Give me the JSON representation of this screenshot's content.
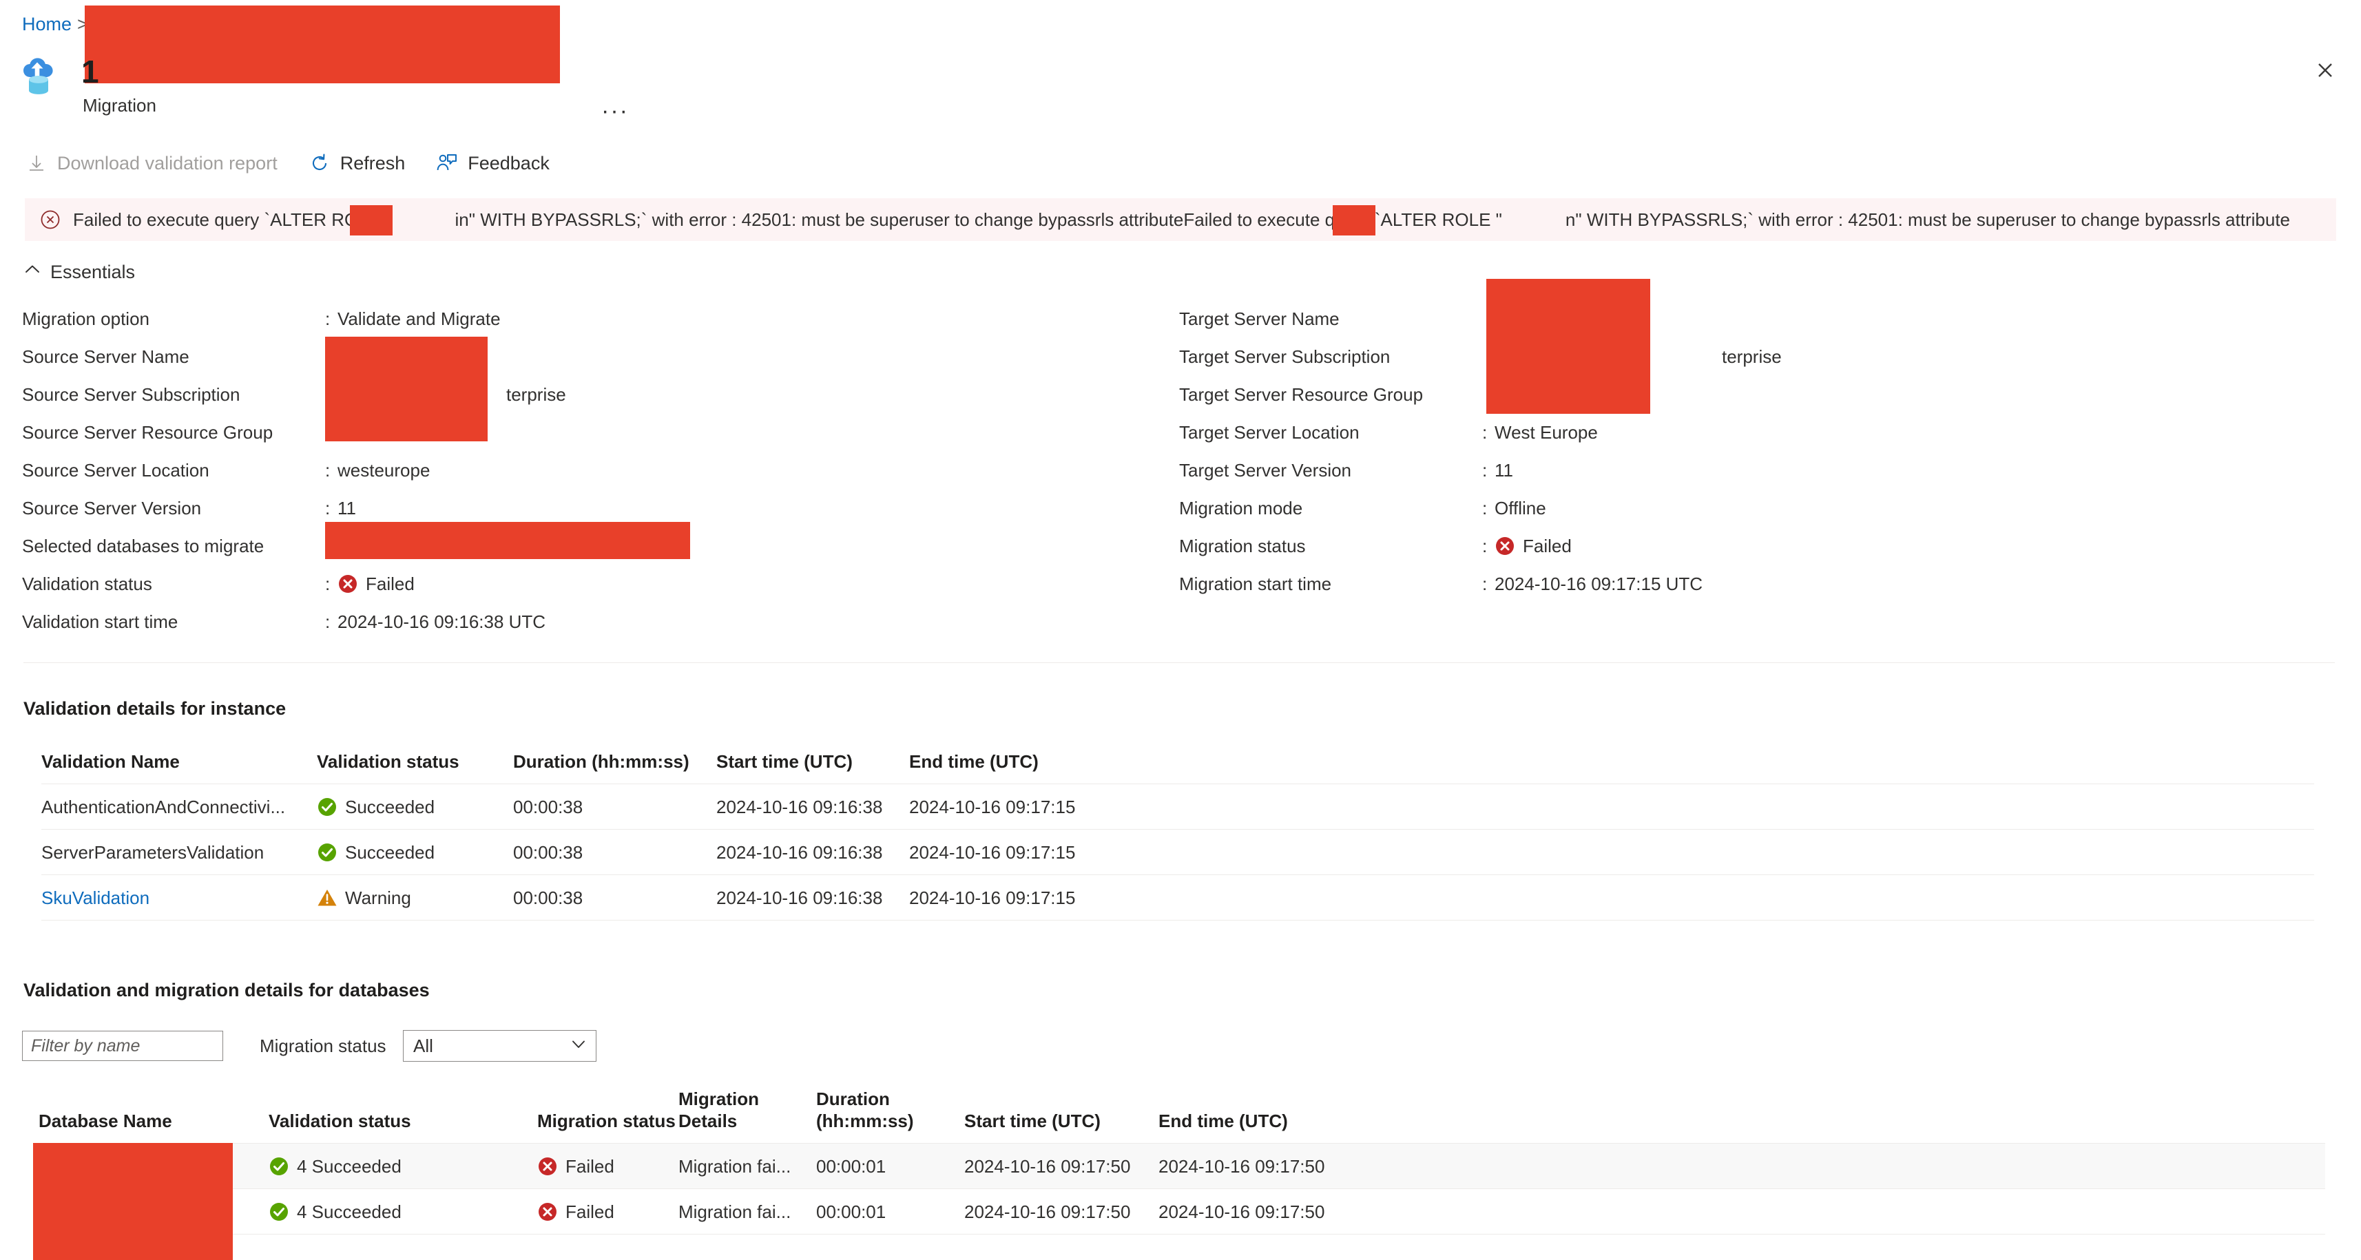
{
  "breadcrumb": {
    "home": "Home",
    "separator": ">"
  },
  "header": {
    "title_visible_prefix": "1",
    "subtitle": "Migration",
    "resource_icon": "database-migration-icon",
    "more_menu": "···",
    "close": "close-icon"
  },
  "commandbar": {
    "download_report": "Download validation report",
    "refresh": "Refresh",
    "feedback": "Feedback"
  },
  "error_banner": {
    "icon": "error-circle-icon",
    "text_part1": "Failed to execute query `ALTER ROLE \"",
    "text_part2": "in\" WITH BYPASSRLS;` with error : 42501: must be superuser to change bypassrls attributeFailed to execute query `ALTER ROLE \"",
    "text_part3": "n\" WITH BYPASSRLS;` with error : 42501: must be superuser to change bypassrls attribute"
  },
  "essentials": {
    "toggle_label": "Essentials",
    "left": [
      {
        "key": "Migration option",
        "value": "Validate and Migrate",
        "status": ""
      },
      {
        "key": "Source Server Name",
        "value": "",
        "status": ""
      },
      {
        "key": "Source Server Subscription",
        "value": "terprise",
        "status": ""
      },
      {
        "key": "Source Server Resource Group",
        "value": "",
        "status": ""
      },
      {
        "key": "Source Server Location",
        "value": "westeurope",
        "status": ""
      },
      {
        "key": "Source Server Version",
        "value": "11",
        "status": ""
      },
      {
        "key": "Selected databases to migrate",
        "value": "",
        "status": ""
      },
      {
        "key": "Validation status",
        "value": "Failed",
        "status": "failed"
      },
      {
        "key": "Validation start time",
        "value": "2024-10-16 09:16:38 UTC",
        "status": ""
      }
    ],
    "right": [
      {
        "key": "Target Server Name",
        "value": "",
        "status": ""
      },
      {
        "key": "Target Server Subscription",
        "value": "terprise",
        "status": ""
      },
      {
        "key": "Target Server Resource Group",
        "value": "",
        "status": ""
      },
      {
        "key": "Target Server Location",
        "value": "West Europe",
        "status": ""
      },
      {
        "key": "Target Server Version",
        "value": "11",
        "status": ""
      },
      {
        "key": "Migration mode",
        "value": "Offline",
        "status": ""
      },
      {
        "key": "Migration status",
        "value": "Failed",
        "status": "failed"
      },
      {
        "key": "Migration start time",
        "value": "2024-10-16 09:17:15 UTC",
        "status": ""
      }
    ]
  },
  "instance_section": {
    "title": "Validation details for instance",
    "columns": [
      "Validation Name",
      "Validation status",
      "Duration (hh:mm:ss)",
      "Start time (UTC)",
      "End time (UTC)"
    ],
    "rows": [
      {
        "name": "AuthenticationAndConnectivi...",
        "is_link": false,
        "status": "Succeeded",
        "status_kind": "succeeded",
        "duration": "00:00:38",
        "start": "2024-10-16 09:16:38",
        "end": "2024-10-16 09:17:15"
      },
      {
        "name": "ServerParametersValidation",
        "is_link": false,
        "status": "Succeeded",
        "status_kind": "succeeded",
        "duration": "00:00:38",
        "start": "2024-10-16 09:16:38",
        "end": "2024-10-16 09:17:15"
      },
      {
        "name": "SkuValidation",
        "is_link": true,
        "status": "Warning",
        "status_kind": "warning",
        "duration": "00:00:38",
        "start": "2024-10-16 09:16:38",
        "end": "2024-10-16 09:17:15"
      }
    ]
  },
  "databases_section": {
    "title": "Validation and migration details for databases",
    "filter_placeholder": "Filter by name",
    "filter_value": "",
    "migration_status_label": "Migration status",
    "migration_status_value": "All",
    "columns": [
      "Database Name",
      "Validation status",
      "Migration status",
      "Migration Details",
      "Duration (hh:mm:ss)",
      "Start time (UTC)",
      "End time (UTC)"
    ],
    "rows": [
      {
        "db_name": "",
        "validation_status": "4 Succeeded",
        "validation_kind": "succeeded",
        "migration_status": "Failed",
        "migration_kind": "failed",
        "migration_details": "Migration fai...",
        "duration": "00:00:01",
        "start": "2024-10-16 09:17:50",
        "end": "2024-10-16 09:17:50"
      },
      {
        "db_name": "",
        "validation_status": "4 Succeeded",
        "validation_kind": "succeeded",
        "migration_status": "Failed",
        "migration_kind": "failed",
        "migration_details": "Migration fai...",
        "duration": "00:00:01",
        "start": "2024-10-16 09:17:50",
        "end": "2024-10-16 09:17:50"
      }
    ]
  },
  "colors": {
    "redaction": "#e8402a",
    "link": "#0f6cbd",
    "success": "#57a300",
    "failed": "#c62828",
    "warning": "#d4820a",
    "error_banner_bg": "#fdf3f4",
    "row_alt_bg": "#f8f8f8"
  }
}
